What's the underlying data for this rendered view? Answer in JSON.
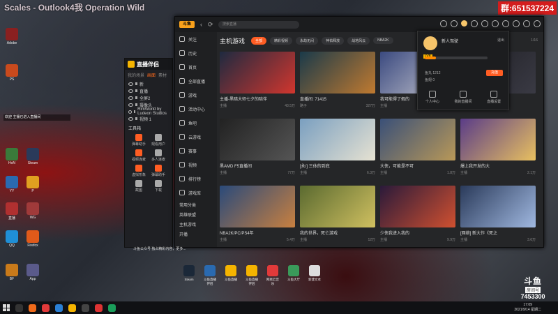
{
  "overlay": {
    "title": "Scales - Outlook4我 Operation Wild",
    "group": "群:651537224",
    "notification": "欢迎  主播已进入直播间",
    "bottom_msg": "斗鱼公众号  独占精彩内容，更多...",
    "colors": {
      "accent": "#ff5d23",
      "group_bg": "#d31d1d"
    }
  },
  "desktop": {
    "icons": [
      {
        "label": "Adobe"
      },
      {
        "label": "PS"
      },
      {
        "label": "HoN"
      },
      {
        "label": "YY"
      },
      {
        "label": "直播"
      },
      {
        "label": "QQ"
      },
      {
        "label": "BF"
      },
      {
        "label": "Steam"
      },
      {
        "label": "P"
      },
      {
        "label": "WG"
      },
      {
        "label": "Firefox"
      },
      {
        "label": "App"
      }
    ],
    "dock": [
      {
        "label": "Steam"
      },
      {
        "label": "斗鱼直播伴侣"
      },
      {
        "label": "斗鱼直播"
      },
      {
        "label": "斗鱼直播伴侣"
      },
      {
        "label": "网易云音乐"
      },
      {
        "label": "斗鱼大厅"
      },
      {
        "label": "新建文本"
      }
    ]
  },
  "live_companion": {
    "title": "直播伴侣",
    "tabs": [
      "我的场景",
      "画面",
      "素材"
    ],
    "scenes": [
      {
        "label": "新"
      },
      {
        "label": "直播"
      },
      {
        "label": "全屏2"
      },
      {
        "label": "摄像头"
      },
      {
        "label": "RimWorld by Ludeon Studios"
      },
      {
        "label": "视频 1"
      }
    ],
    "tools_title": "工具箱",
    "tools": [
      {
        "label": "弹幕助手"
      },
      {
        "label": "观看用户"
      },
      {
        "label": "视频连麦"
      },
      {
        "label": "多人连麦"
      },
      {
        "label": "虚拟形象"
      },
      {
        "label": "弹幕助手"
      },
      {
        "label": "截图"
      },
      {
        "label": "下载"
      }
    ]
  },
  "douyu": {
    "logo": "斗鱼",
    "search_placeholder": "搜索直播",
    "sidebar": [
      {
        "label": "关注"
      },
      {
        "label": "历史"
      },
      {
        "label": "首页"
      },
      {
        "label": "全部直播"
      },
      {
        "label": "游戏"
      },
      {
        "label": "活动中心"
      },
      {
        "label": "鱼吧"
      },
      {
        "label": "云游戏"
      },
      {
        "label": "赛事"
      },
      {
        "label": "视频"
      },
      {
        "label": "排行榜"
      },
      {
        "label": "游戏库"
      }
    ],
    "sidebar_extra": [
      {
        "label": "常用分类"
      },
      {
        "label": "英雄联盟"
      },
      {
        "label": "主机游戏"
      },
      {
        "label": "开播"
      }
    ],
    "category_title": "主机游戏",
    "chips": [
      {
        "label": "全部",
        "active": true
      },
      {
        "label": "精彩视频",
        "active": false
      },
      {
        "label": "永劫无间",
        "active": false
      },
      {
        "label": "神佑释放",
        "active": false
      },
      {
        "label": "战地风云",
        "active": false
      },
      {
        "label": "NBA2K",
        "active": false
      }
    ],
    "page_indicator": "1/16",
    "cards": [
      {
        "title": "主播-黑暗大师七夕的陪伴",
        "streamer": "主播",
        "viewers": "43.5万",
        "c1": "#1e2a40",
        "c2": "#d1362e"
      },
      {
        "title": "直播间: 71415",
        "streamer": "路子",
        "viewers": "327万",
        "c1": "#1a3a4a",
        "c2": "#c07a30"
      },
      {
        "title": "我可能得了假的",
        "streamer": "主播",
        "viewers": "3.2万",
        "c1": "#3b4a80",
        "c2": "#c8c8d0"
      },
      {
        "title": "",
        "streamer": "",
        "viewers": "",
        "c1": "#1f1f24",
        "c2": "#3a3a44"
      },
      {
        "title": "黑AMD F5直播间",
        "streamer": "主播",
        "viewers": "77万",
        "c1": "#222",
        "c2": "#555"
      },
      {
        "title": "[永/] 三体的到底",
        "streamer": "主播",
        "viewers": "6.3万",
        "c1": "#7a9fc0",
        "c2": "#e6e2d2"
      },
      {
        "title": "大侠，可能是不可",
        "streamer": "主播",
        "viewers": "1.8万",
        "c1": "#3a5078",
        "c2": "#b89858"
      },
      {
        "title": "爆上我开发的大",
        "streamer": "主播",
        "viewers": "2.1万",
        "c1": "#5a3c88",
        "c2": "#e8c060"
      },
      {
        "title": "NBA2K/PC/PS4年",
        "streamer": "主播",
        "viewers": "5.4万",
        "c1": "#2a4a7a",
        "c2": "#c88040"
      },
      {
        "title": "我的世界，死亡游戏",
        "streamer": "主播",
        "viewers": "12万",
        "c1": "#5a6a30",
        "c2": "#d0c060"
      },
      {
        "title": "少侠我进入我的",
        "streamer": "主播",
        "viewers": "9.9万",
        "c1": "#2a1a3a",
        "c2": "#d05030"
      },
      {
        "title": "[网络] 新大作《死之",
        "streamer": "主播",
        "viewers": "3.6万",
        "c1": "#2a3a5a",
        "c2": "#a0b8e0"
      }
    ],
    "popup": {
      "name": "新人驾驶",
      "logout": "退出",
      "level": "LV8",
      "stats": [
        {
          "label": "鱼丸 1212"
        },
        {
          "label": "鱼翅 0"
        }
      ],
      "recharge": "充值",
      "actions": [
        {
          "label": "个人中心"
        },
        {
          "label": "我的直播间"
        },
        {
          "label": "直播设置"
        }
      ]
    }
  },
  "watermark": {
    "logo": "斗鱼",
    "room_label": "房间号",
    "room_number": "7453300"
  },
  "taskbar": {
    "time": "17:09",
    "date": "2021/9/14 星期二"
  }
}
